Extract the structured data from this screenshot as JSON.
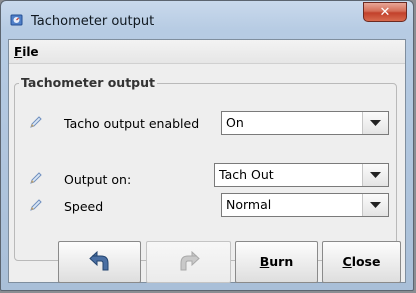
{
  "window": {
    "title": "Tachometer output",
    "close_glyph": "✕",
    "icon": "app-icon"
  },
  "menu": {
    "file": {
      "mnemonic": "F",
      "rest": "ile"
    }
  },
  "panel": {
    "title": "Tachometer output"
  },
  "fields": [
    {
      "label": "Tacho output enabled",
      "value": "On",
      "icon": "edit-pencil-icon"
    },
    {
      "label": "Output on:",
      "value": "Tach Out",
      "icon": "edit-pencil-icon"
    },
    {
      "label": "Speed",
      "value": "Normal",
      "icon": "edit-pencil-icon"
    }
  ],
  "buttons": {
    "undo": {
      "icon": "undo-icon",
      "enabled": true
    },
    "redo": {
      "icon": "redo-icon",
      "enabled": false
    },
    "burn": {
      "mnemonic": "B",
      "rest": "urn"
    },
    "close": {
      "mnemonic": "C",
      "rest": "lose"
    }
  },
  "colors": {
    "accent": "#2b5fb4",
    "close_red": "#c2412b"
  }
}
